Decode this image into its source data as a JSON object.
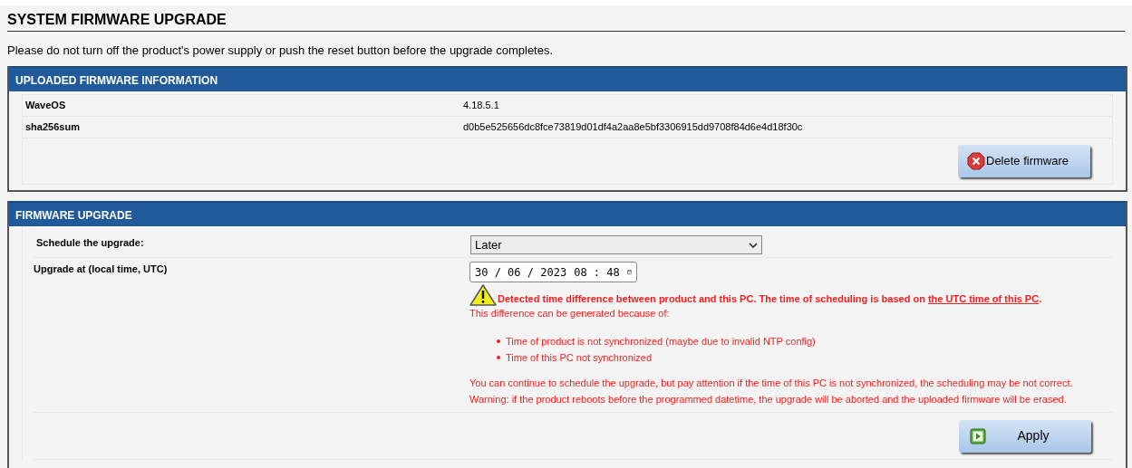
{
  "page_title": "SYSTEM FIRMWARE UPGRADE",
  "notice": "Please do not turn off the product's power supply or push the reset button before the upgrade completes.",
  "uploaded_panel": {
    "title": "UPLOADED FIRMWARE INFORMATION",
    "rows": [
      {
        "label": "WaveOS",
        "value": "4.18.5.1"
      },
      {
        "label": "sha256sum",
        "value": "d0b5e525656dc8fce73819d01df4a2aa8e5bf3306915dd9708f84d6e4d18f30c"
      }
    ],
    "button": "Delete firmware"
  },
  "upgrade_panel": {
    "title": "FIRMWARE UPGRADE",
    "schedule": {
      "label": "Schedule the upgrade:",
      "value": "Later"
    },
    "upgrade_at": {
      "label": "Upgrade at (local time, UTC)",
      "date": "30 / 06 / 2023",
      "time": "08 : 48"
    },
    "warning": {
      "headline": "Detected time difference between product and this PC. The time of scheduling is based on ",
      "link": "the UTC time of this PC",
      "after": ".",
      "intro": "This difference can be generated because of:",
      "reasons": [
        "Time of product is not synchronized (maybe due to invalid NTP config)",
        "Time of this PC not synchronized"
      ],
      "notes": [
        "You can continue to schedule the upgrade, but pay attention if the time of this PC is not synchronized, the scheduling may be not correct.",
        "Warning: if the product reboots before the programmed datetime, the upgrade will be aborted and the uploaded firmware will be erased."
      ]
    },
    "button": "Apply"
  }
}
